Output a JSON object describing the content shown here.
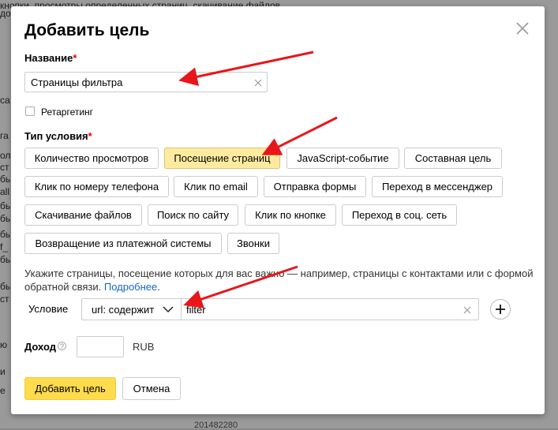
{
  "background": {
    "top_text": "кнопки, просмотры определенных страниц, скачивание файлов.",
    "left_fragments": [
      "до",
      "са",
      "га",
      "ол",
      "ст",
      "бь",
      "all",
      "бь",
      "бь",
      "бь",
      "f_",
      "бь",
      "бь",
      "ст",
      "ю",
      "и",
      "е"
    ],
    "bottom_text": "201482280"
  },
  "modal": {
    "title": "Добавить цель",
    "name_label": "Название",
    "required_mark": "*",
    "name_value": "Страницы фильтра",
    "retargeting_label": "Ретаргетинг",
    "condition_type_label": "Тип условия",
    "condition_types": [
      "Количество просмотров",
      "Посещение страниц",
      "JavaScript-событие",
      "Составная цель",
      "Клик по номеру телефона",
      "Клик по email",
      "Отправка формы",
      "Переход в мессенджер",
      "Скачивание файлов",
      "Поиск по сайту",
      "Клик по кнопке",
      "Переход в соц. сеть",
      "Возвращение из платежной системы",
      "Звонки"
    ],
    "selected_condition_type": "Посещение страниц",
    "hint_text": "Укажите страницы, посещение которых для вас важно — например, страницы с контактами или с формой обратной связи. ",
    "hint_link": "Подробнее",
    "hint_end": ".",
    "condition_label": "Условие",
    "condition_operator": "url: содержит",
    "condition_value": "filter",
    "income_label": "Доход",
    "income_help": "?",
    "income_value": "",
    "currency": "RUB",
    "submit_label": "Добавить цель",
    "cancel_label": "Отмена"
  },
  "colors": {
    "accent_yellow": "#ffdb4d",
    "selected_chip": "#ffeba0",
    "link": "#1a66c8",
    "required": "#ee0000",
    "arrow": "#e8161b"
  },
  "icons": [
    "close-icon",
    "clear-icon",
    "chevron-down-icon",
    "plus-icon",
    "help-icon",
    "annotation-arrow-icon"
  ]
}
